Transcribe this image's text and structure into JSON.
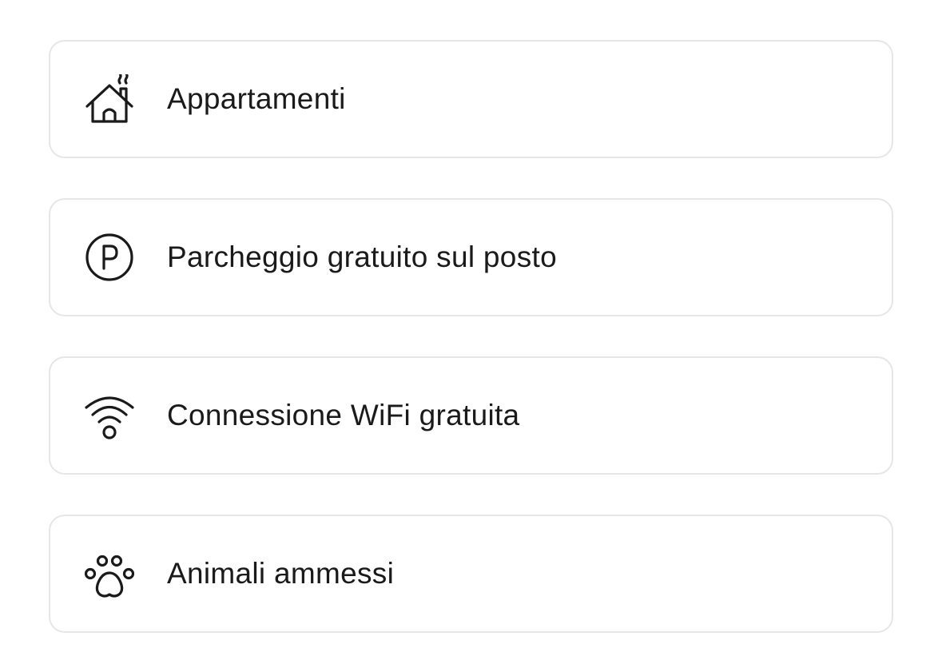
{
  "facilities": {
    "items": [
      {
        "label": "Appartamenti",
        "icon": "house-icon"
      },
      {
        "label": "Parcheggio gratuito sul posto",
        "icon": "parking-icon"
      },
      {
        "label": "Connessione WiFi gratuita",
        "icon": "wifi-icon"
      },
      {
        "label": "Animali ammessi",
        "icon": "paw-icon"
      }
    ]
  },
  "colors": {
    "text": "#1a1a1a",
    "card_border": "#e6e6e6",
    "background": "#ffffff"
  }
}
